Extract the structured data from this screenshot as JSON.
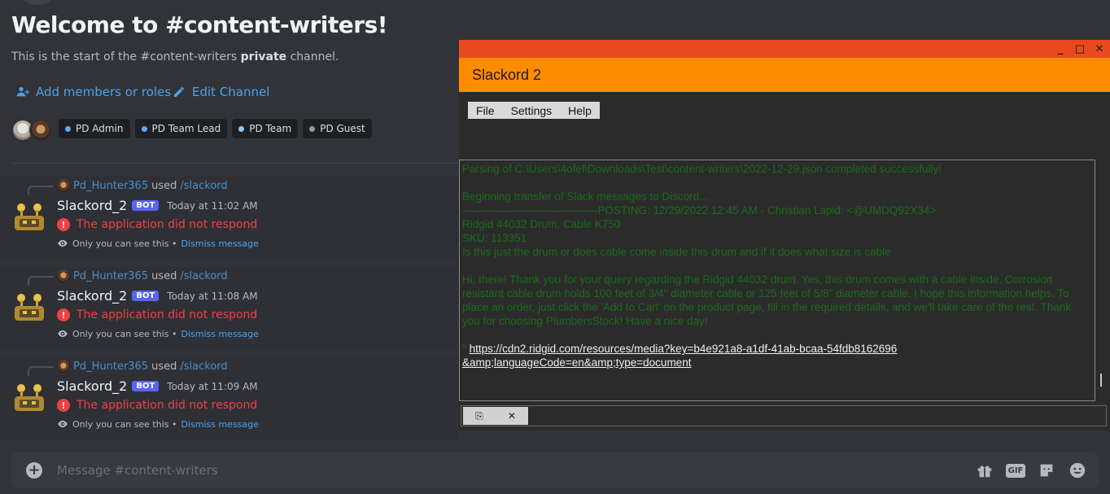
{
  "channel": {
    "welcome_title": "Welcome to #content-writers!",
    "sub_prefix": "This is the start of the #content-writers ",
    "sub_bold": "private",
    "sub_suffix": " channel.",
    "add_members_label": "Add members or roles",
    "edit_channel_label": "Edit Channel",
    "roles": [
      {
        "label": "PD Admin",
        "color": "#5ea8f5"
      },
      {
        "label": "PD Team Lead",
        "color": "#5ea8f5"
      },
      {
        "label": "PD Team",
        "color": "#8ec8ff"
      },
      {
        "label": "PD Guest",
        "color": "#949ba4"
      }
    ]
  },
  "messages": [
    {
      "reply_user": "Pd_Hunter365",
      "reply_used": "used",
      "reply_command": "/slackord",
      "author": "Slackord_2",
      "badge": "BOT",
      "time": "Today at 11:02 AM",
      "error": "The application did not respond",
      "only_you": "Only you can see this •",
      "dismiss": "Dismiss message"
    },
    {
      "reply_user": "Pd_Hunter365",
      "reply_used": "used",
      "reply_command": "/slackord",
      "author": "Slackord_2",
      "badge": "BOT",
      "time": "Today at 11:08 AM",
      "error": "The application did not respond",
      "only_you": "Only you can see this •",
      "dismiss": "Dismiss message"
    },
    {
      "reply_user": "Pd_Hunter365",
      "reply_used": "used",
      "reply_command": "/slackord",
      "author": "Slackord_2",
      "badge": "BOT",
      "time": "Today at 11:09 AM",
      "error": "The application did not respond",
      "only_you": "Only you can see this •",
      "dismiss": "Dismiss message"
    }
  ],
  "composer": {
    "placeholder": "Message #content-writers",
    "icons": [
      "gift-icon",
      "gif-icon",
      "sticker-icon",
      "emoji-icon"
    ],
    "gif_label": "GIF"
  },
  "slackord": {
    "window_controls": {
      "minimize": "_",
      "maximize": "□",
      "close": "✕"
    },
    "title": "Slackord 2",
    "menu": [
      "File",
      "Settings",
      "Help"
    ],
    "log_lines": [
      "Parsing of C:\\Users\\4ofel\\Downloads\\Test\\content-writers\\2022-12-29.json completed successfully!",
      "",
      "Beginning transfer of Slack messages to Discord...",
      "-------------------------------------POSTING: 12/29/2022 12:45 AM - Christian Lapid: <@UMDQ92X34>",
      "Ridgid 44032 Drum, Cable K750",
      "SKU: 113351",
      "Is this just the drum or does cable come inside this drum and if it does what size is cable",
      "",
      "Hi, there! Thank you for your query regarding the Ridgid 44032 drum. Yes, this drum comes with a cable inside. Corrosion resistant cable drum holds 100 feet of 3/4\" diameter cable or 125 feet of 5/8\" diameter cable. I hope this information helps. To place an order, just click the 'Add to Cart' on the product page, fill in the required details, and we'll take care of the rest. Thank you for choosing PlumbersStock! Have a nice day!",
      ""
    ],
    "log_link_line1": "https://cdn2.ridgid.com/resources/media?key=b4e921a8-a1df-41ab-bcaa-54fdb8162696",
    "log_link_line2": "&amp;languageCode=en&amp;type=document",
    "log_link_prefix": "\"",
    "bottom_buttons": {
      "copy": "⎘",
      "clear": "✕"
    },
    "colors": {
      "titlebar": "#e8491d",
      "appbar": "#ff8c00",
      "log_text": "#1a6b1a"
    }
  }
}
